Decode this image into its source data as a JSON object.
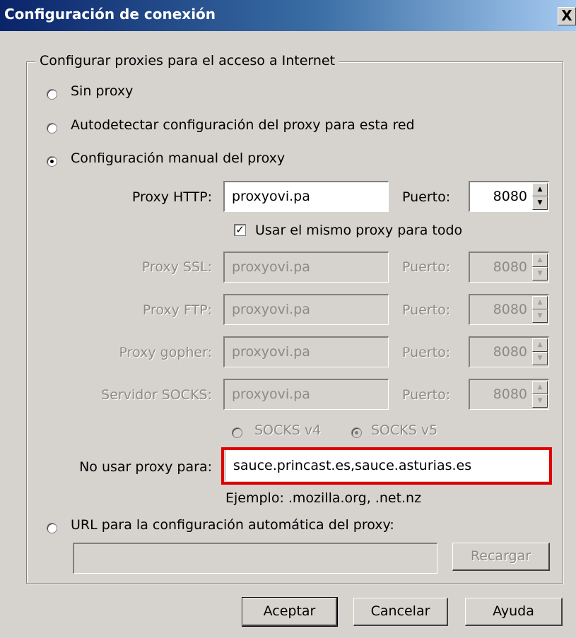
{
  "window": {
    "title": "Configuración de conexión",
    "close_glyph": "X"
  },
  "group": {
    "legend": "Configurar proxies para el acceso a Internet"
  },
  "radios": {
    "no_proxy": "Sin proxy",
    "autodetect": "Autodetectar configuración del proxy para esta red",
    "manual": "Configuración manual del proxy",
    "auto_url": "URL para la configuración automática del proxy:",
    "selected": "manual"
  },
  "proxies": [
    {
      "label": "Proxy HTTP:",
      "host": "proxyovi.pa",
      "port_label": "Puerto:",
      "port": "8080",
      "enabled": true
    },
    {
      "label": "Proxy SSL:",
      "host": "proxyovi.pa",
      "port_label": "Puerto:",
      "port": "8080",
      "enabled": false
    },
    {
      "label": "Proxy FTP:",
      "host": "proxyovi.pa",
      "port_label": "Puerto:",
      "port": "8080",
      "enabled": false
    },
    {
      "label": "Proxy gopher:",
      "host": "proxyovi.pa",
      "port_label": "Puerto:",
      "port": "8080",
      "enabled": false
    },
    {
      "label": "Servidor SOCKS:",
      "host": "proxyovi.pa",
      "port_label": "Puerto:",
      "port": "8080",
      "enabled": false
    }
  ],
  "same_proxy": {
    "label": "Usar el mismo proxy para todo",
    "checked": true
  },
  "socks": {
    "v4": "SOCKS v4",
    "v5": "SOCKS v5",
    "selected": "v5"
  },
  "no_proxy_for": {
    "label": "No usar proxy para:",
    "value": "sauce.princast.es,sauce.asturias.es",
    "example": "Ejemplo: .mozilla.org, .net.nz"
  },
  "auto_url": {
    "value": "",
    "reload_label": "Recargar"
  },
  "buttons": {
    "ok": "Aceptar",
    "cancel": "Cancelar",
    "help": "Ayuda"
  },
  "colors": {
    "highlight": "#e00000",
    "titlebar_start": "#0a246a",
    "titlebar_end": "#a6caf0"
  }
}
